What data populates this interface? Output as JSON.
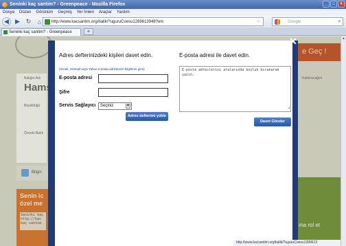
{
  "window": {
    "title": "Seninki kaç santim? - Greenpeace - Mozilla Firefox"
  },
  "menu": [
    "Dosya",
    "Düzen",
    "Görünüm",
    "Geçmiş",
    "Yer İmleri",
    "Araçlar",
    "Yardım"
  ],
  "url": "http://www.kacsantim.org/balik/?uguruCoesu1289613948?em",
  "search_placeholder": "Google",
  "tab": {
    "label": "Seninki kaç santim? - Greenpeace"
  },
  "page_bg": {
    "banner": "e Geç !",
    "label1": "Balığın Adı",
    "name": "Hams",
    "label2": "Büyüklüğü",
    "label3": "Önceki Balık",
    "bilgin": "Bilgin",
    "orange_text": "Senin ic özel me",
    "code": "Seninki kaç http://kac kaç santim",
    "right_label": "Kaldıracağım",
    "green_text": "ına rol et"
  },
  "modal": {
    "left_heading": "Adres defterinizdeki kişileri davet edin.",
    "note": "(Gmail, Hotmail veya Yahoo e-posta adresinizin bilgilerini girin)",
    "email_label": "E-posta adresi",
    "password_label": "Şifre",
    "provider_label": "Servis Sağlayıcı",
    "provider_value": "Seçiniz",
    "load_button": "Adres defterimi yükle",
    "right_heading": "E-posta adresi ile davet edin.",
    "textarea_text": "E-posta adreslerini aralarında boşluk bırakarak yazın.",
    "send_button": "Davet Gönder",
    "close": "✕"
  },
  "status_text": "http://www.kacsantim.org/balik/?uguruCoesu1289613"
}
